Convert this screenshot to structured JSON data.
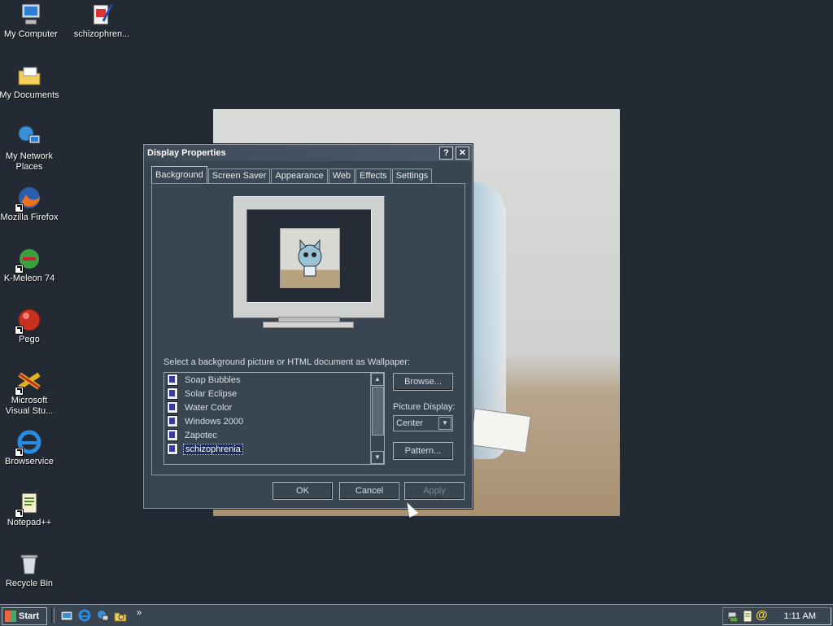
{
  "desktop": {
    "icons": [
      {
        "label": "My Computer"
      },
      {
        "label": "schizophren..."
      },
      {
        "label": "My Documents"
      },
      {
        "label": "My Network Places"
      },
      {
        "label": "Mozilla Firefox"
      },
      {
        "label": "K-Meleon 74"
      },
      {
        "label": "Pego"
      },
      {
        "label": "Microsoft Visual Stu..."
      },
      {
        "label": "Browservice"
      },
      {
        "label": "Notepad++"
      },
      {
        "label": "Recycle Bin"
      }
    ]
  },
  "dialog": {
    "title": "Display Properties",
    "help_label": "?",
    "close_label": "✕",
    "tabs": [
      {
        "label": "Background"
      },
      {
        "label": "Screen Saver"
      },
      {
        "label": "Appearance"
      },
      {
        "label": "Web"
      },
      {
        "label": "Effects"
      },
      {
        "label": "Settings"
      }
    ],
    "wallpaper_caption": "Select a background picture or HTML document as Wallpaper:",
    "wallpapers": [
      {
        "label": "Soap Bubbles"
      },
      {
        "label": "Solar Eclipse"
      },
      {
        "label": "Water Color"
      },
      {
        "label": "Windows 2000"
      },
      {
        "label": "Zapotec"
      },
      {
        "label": "schizophrenia"
      }
    ],
    "browse_label": "Browse...",
    "picture_display_label": "Picture Display:",
    "picture_display_value": "Center",
    "pattern_label": "Pattern...",
    "ok_label": "OK",
    "cancel_label": "Cancel",
    "apply_label": "Apply"
  },
  "taskbar": {
    "start_label": "Start",
    "clock": "1:11 AM"
  }
}
